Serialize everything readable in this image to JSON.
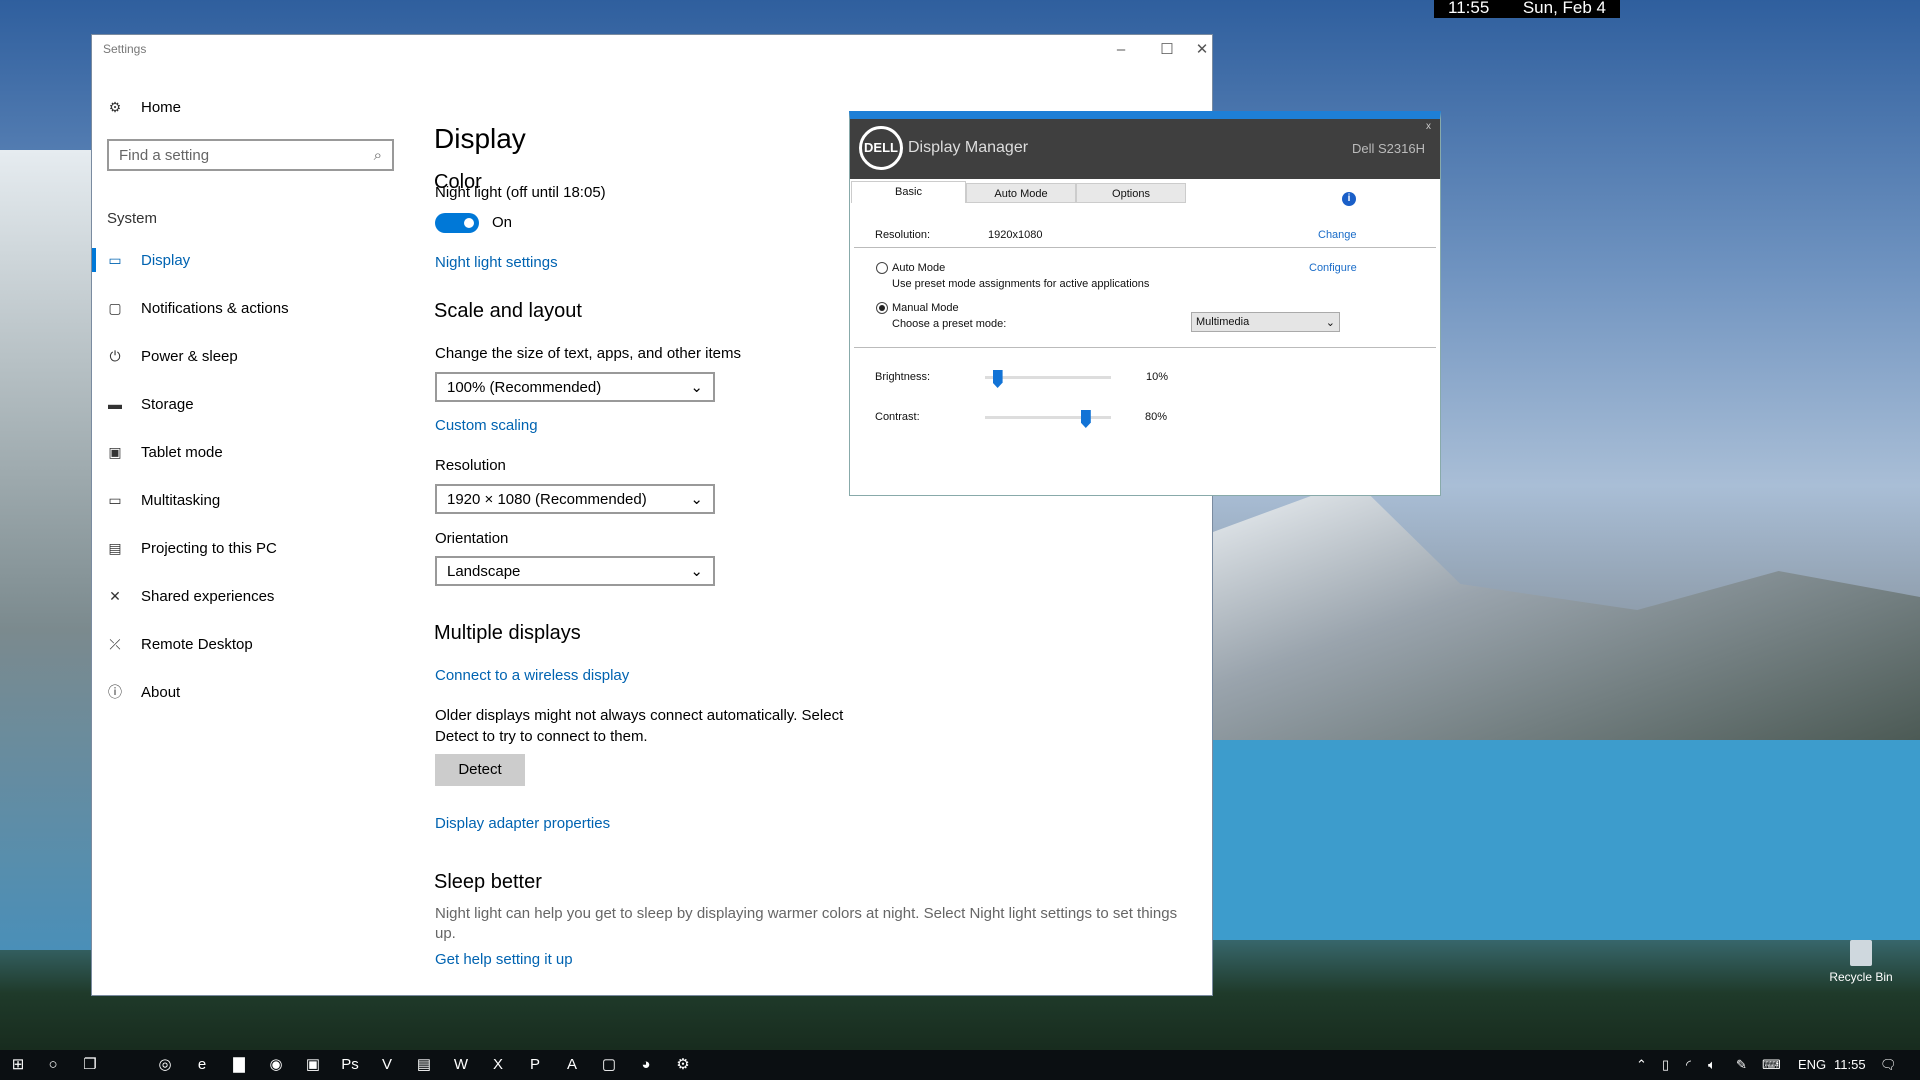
{
  "overlay_clock": {
    "time": "11:55",
    "date": "Sun, Feb  4"
  },
  "settings": {
    "title": "Settings",
    "home": "Home",
    "search_placeholder": "Find a setting",
    "section": "System",
    "nav": [
      {
        "label": "Display",
        "icon": "monitor-icon"
      },
      {
        "label": "Notifications & actions",
        "icon": "notification-icon"
      },
      {
        "label": "Power & sleep",
        "icon": "power-icon"
      },
      {
        "label": "Storage",
        "icon": "storage-icon"
      },
      {
        "label": "Tablet mode",
        "icon": "tablet-icon"
      },
      {
        "label": "Multitasking",
        "icon": "multitasking-icon"
      },
      {
        "label": "Projecting to this PC",
        "icon": "projecting-icon"
      },
      {
        "label": "Shared experiences",
        "icon": "shared-icon"
      },
      {
        "label": "Remote Desktop",
        "icon": "remote-icon"
      },
      {
        "label": "About",
        "icon": "info-icon"
      }
    ],
    "page_title": "Display",
    "color_heading": "Color",
    "night_light_label": "Night light (off until 18:05)",
    "night_light_state": "On",
    "night_light_settings": "Night light settings",
    "scale_heading": "Scale and layout",
    "scale_label": "Change the size of text, apps, and other items",
    "scale_value": "100% (Recommended)",
    "custom_scaling": "Custom scaling",
    "resolution_label": "Resolution",
    "resolution_value": "1920 × 1080 (Recommended)",
    "orientation_label": "Orientation",
    "orientation_value": "Landscape",
    "multi_heading": "Multiple displays",
    "connect_wireless": "Connect to a wireless display",
    "older_text_1": "Older displays might not always connect automatically. Select",
    "older_text_2": "Detect to try to connect to them.",
    "detect": "Detect",
    "adapter_props": "Display adapter properties",
    "sleep_heading": "Sleep better",
    "sleep_text_1": "Night light can help you get to sleep by displaying warmer colors at night. Select Night light settings to set things",
    "sleep_text_2": "up.",
    "get_help": "Get help setting it up"
  },
  "dell": {
    "logo": "DELL",
    "title": "Display Manager",
    "model": "Dell S2316H",
    "close": "x",
    "tabs": [
      "Basic",
      "Auto Mode",
      "Options"
    ],
    "resolution_label": "Resolution:",
    "resolution_value": "1920x1080",
    "change": "Change",
    "auto_mode": "Auto Mode",
    "auto_desc": "Use preset mode assignments for active applications",
    "configure": "Configure",
    "manual_mode": "Manual Mode",
    "preset_label": "Choose a preset mode:",
    "preset_value": "Multimedia",
    "brightness_label": "Brightness:",
    "brightness_value": "10%",
    "brightness": 10,
    "contrast_label": "Contrast:",
    "contrast_value": "80%",
    "contrast": 80
  },
  "desktop": {
    "recycle_bin": "Recycle Bin"
  },
  "taskbar": {
    "apps": [
      "cortana-ring-icon",
      "edge-icon",
      "file-explorer-icon",
      "chrome-icon",
      "app-icon",
      "photoshop-icon",
      "visio-icon",
      "notepad-icon",
      "word-icon",
      "excel-icon",
      "powerpoint-icon",
      "access-icon",
      "app-square-icon",
      "steam-icon",
      "settings-icon"
    ],
    "app_glyphs": [
      "◎",
      "e",
      "▇",
      "◉",
      "▣",
      "Ps",
      "V",
      "▤",
      "W",
      "X",
      "P",
      "A",
      "▢",
      "◕",
      "⚙"
    ],
    "lang": "ENG",
    "time": "11:55"
  }
}
